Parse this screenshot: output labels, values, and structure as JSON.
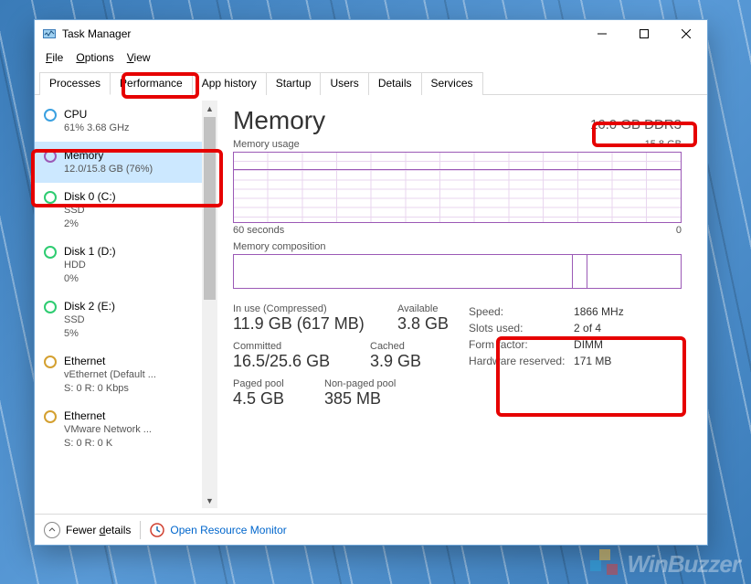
{
  "window": {
    "title": "Task Manager"
  },
  "menu": {
    "file": "File",
    "options": "Options",
    "view": "View"
  },
  "tabs": {
    "processes": "Processes",
    "performance": "Performance",
    "app_history": "App history",
    "startup": "Startup",
    "users": "Users",
    "details": "Details",
    "services": "Services"
  },
  "sidebar": [
    {
      "name": "CPU",
      "sub": "61% 3.68 GHz"
    },
    {
      "name": "Memory",
      "sub": "12.0/15.8 GB (76%)"
    },
    {
      "name": "Disk 0 (C:)",
      "sub1": "SSD",
      "sub2": "2%"
    },
    {
      "name": "Disk 1 (D:)",
      "sub1": "HDD",
      "sub2": "0%"
    },
    {
      "name": "Disk 2 (E:)",
      "sub1": "SSD",
      "sub2": "5%"
    },
    {
      "name": "Ethernet",
      "sub1": "vEthernet (Default ...",
      "sub2": "S: 0 R: 0 Kbps"
    },
    {
      "name": "Ethernet",
      "sub1": "VMware Network ...",
      "sub2": "S: 0 R: 0 K"
    }
  ],
  "main": {
    "title": "Memory",
    "capacity": "16.0 GB DDR3",
    "usage_label": "Memory usage",
    "usage_max": "15.8 GB",
    "axis_left": "60 seconds",
    "axis_right": "0",
    "composition_label": "Memory composition",
    "stats": {
      "in_use_label": "In use (Compressed)",
      "in_use_value": "11.9 GB (617 MB)",
      "available_label": "Available",
      "available_value": "3.8 GB",
      "committed_label": "Committed",
      "committed_value": "16.5/25.6 GB",
      "cached_label": "Cached",
      "cached_value": "3.9 GB",
      "paged_label": "Paged pool",
      "paged_value": "4.5 GB",
      "nonpaged_label": "Non-paged pool",
      "nonpaged_value": "385 MB"
    },
    "specs": {
      "speed_label": "Speed:",
      "speed_value": "1866 MHz",
      "slots_label": "Slots used:",
      "slots_value": "2 of 4",
      "form_label": "Form factor:",
      "form_value": "DIMM",
      "reserved_label": "Hardware reserved:",
      "reserved_value": "171 MB"
    }
  },
  "footer": {
    "fewer": "Fewer details",
    "resource_monitor": "Open Resource Monitor"
  },
  "watermark": "WinBuzzer"
}
